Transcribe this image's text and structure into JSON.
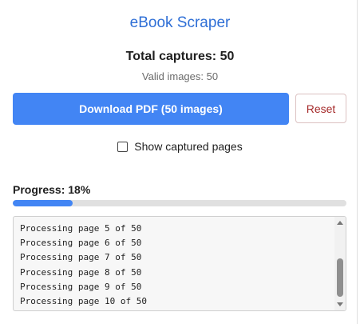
{
  "app": {
    "title": "eBook Scraper"
  },
  "stats": {
    "total_captures": "Total captures: 50",
    "valid_images": "Valid images: 50"
  },
  "actions": {
    "download_label": "Download PDF (50 images)",
    "reset_label": "Reset"
  },
  "toggle": {
    "label": "Show captured pages",
    "checked": false
  },
  "progress": {
    "label": "Progress: 18%",
    "value": 0.18
  },
  "log": {
    "lines": [
      "Processing page 5 of 50",
      "Processing page 6 of 50",
      "Processing page 7 of 50",
      "Processing page 8 of 50",
      "Processing page 9 of 50",
      "Processing page 10 of 50"
    ]
  },
  "colors": {
    "accent": "#4285f4",
    "title": "#2f6fd6",
    "reset_text": "#a52a2a",
    "progress_track": "#e0e0e0"
  },
  "icons": {
    "checkbox": "checkbox-unchecked-icon",
    "scroll_up": "triangle-up-icon",
    "scroll_down": "triangle-down-icon"
  }
}
